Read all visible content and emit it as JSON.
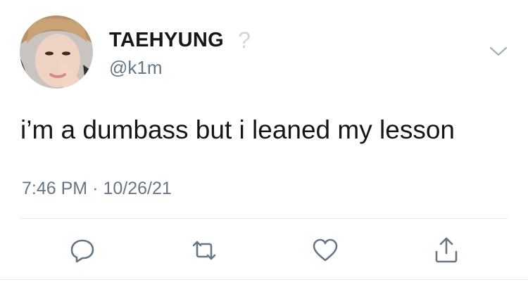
{
  "tweet": {
    "author": {
      "display_name": "TAEHYUNG",
      "badge_glyph": "?",
      "handle": "@k1m"
    },
    "text": "i’m a dumbass but i leaned my lesson",
    "timestamp": {
      "time": "7:46 PM",
      "separator": "·",
      "date": "10/26/21"
    }
  },
  "icons": {
    "menu": "chevron-down-icon",
    "reply": "reply-icon",
    "retweet": "retweet-icon",
    "like": "heart-icon",
    "share": "share-icon"
  },
  "colors": {
    "text": "#14171a",
    "secondary": "#657786",
    "icon": "#657786",
    "divider": "#e1e8ed",
    "badge": "#d0d5d9"
  }
}
